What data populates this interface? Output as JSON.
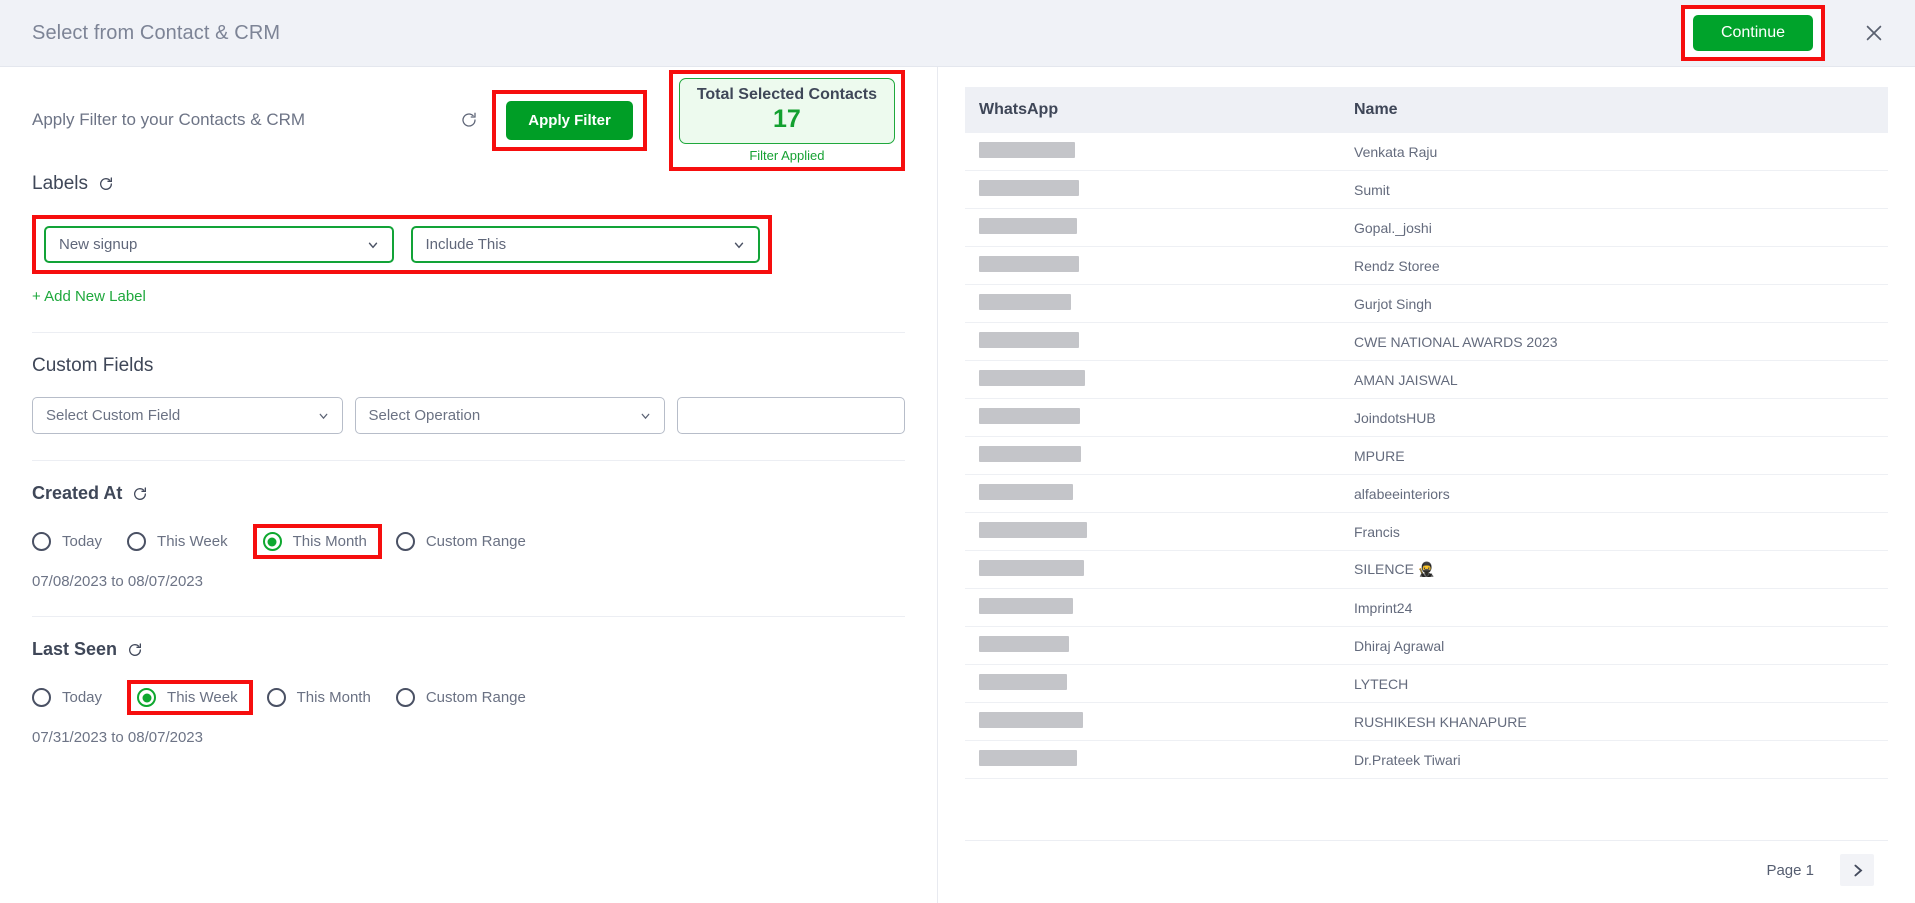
{
  "header": {
    "title": "Select from Contact & CRM",
    "continue_label": "Continue",
    "close_icon": "close-icon"
  },
  "filter": {
    "label": "Apply Filter to your Contacts & CRM",
    "refresh_icon": "refresh-icon",
    "apply_label": "Apply Filter",
    "total_title": "Total Selected Contacts",
    "total_value": "17",
    "status": "Filter Applied",
    "accent_green": "#00a32b",
    "highlight_red": "#f60e0e"
  },
  "labels_section": {
    "title": "Labels",
    "label_value": "New signup",
    "condition_value": "Include This",
    "add_new_label": "+ Add New Label"
  },
  "custom_fields": {
    "title": "Custom Fields",
    "field_placeholder": "Select Custom Field",
    "operation_placeholder": "Select Operation",
    "value_input": "",
    "value_placeholder": ""
  },
  "created_at": {
    "title": "Created At",
    "options": [
      {
        "label": "Today",
        "checked": false,
        "highlighted": false
      },
      {
        "label": "This Week",
        "checked": false,
        "highlighted": false
      },
      {
        "label": "This Month",
        "checked": true,
        "highlighted": true
      },
      {
        "label": "Custom Range",
        "checked": false,
        "highlighted": false
      }
    ],
    "range_text": "07/08/2023 to 08/07/2023"
  },
  "last_seen": {
    "title": "Last Seen",
    "options": [
      {
        "label": "Today",
        "checked": false,
        "highlighted": false
      },
      {
        "label": "This Week",
        "checked": true,
        "highlighted": true
      },
      {
        "label": "This Month",
        "checked": false,
        "highlighted": false
      },
      {
        "label": "Custom Range",
        "checked": false,
        "highlighted": false
      }
    ],
    "range_text": "07/31/2023 to 08/07/2023"
  },
  "contacts": {
    "columns": [
      "WhatsApp",
      "Name"
    ],
    "rows": [
      {
        "whatsapp": "",
        "redact_width": 96,
        "name": "Venkata Raju"
      },
      {
        "whatsapp": "",
        "redact_width": 100,
        "name": "Sumit"
      },
      {
        "whatsapp": "",
        "redact_width": 98,
        "name": "Gopal._joshi"
      },
      {
        "whatsapp": "",
        "redact_width": 100,
        "name": "Rendz Storee"
      },
      {
        "whatsapp": "",
        "redact_width": 92,
        "name": "Gurjot Singh"
      },
      {
        "whatsapp": "",
        "redact_width": 100,
        "name": "CWE NATIONAL AWARDS 2023"
      },
      {
        "whatsapp": "",
        "redact_width": 106,
        "name": "AMAN JAISWAL"
      },
      {
        "whatsapp": "",
        "redact_width": 101,
        "name": "JoindotsHUB"
      },
      {
        "whatsapp": "",
        "redact_width": 102,
        "name": "MPURE"
      },
      {
        "whatsapp": "",
        "redact_width": 94,
        "name": "alfabeeinteriors"
      },
      {
        "whatsapp": "",
        "redact_width": 108,
        "name": "Francis"
      },
      {
        "whatsapp": "",
        "redact_width": 105,
        "name": "SILENCE 🥷"
      },
      {
        "whatsapp": "",
        "redact_width": 94,
        "name": "Imprint24"
      },
      {
        "whatsapp": "",
        "redact_width": 90,
        "name": "Dhiraj Agrawal"
      },
      {
        "whatsapp": "",
        "redact_width": 88,
        "name": "LYTECH"
      },
      {
        "whatsapp": "",
        "redact_width": 104,
        "name": "RUSHIKESH KHANAPURE"
      },
      {
        "whatsapp": "",
        "redact_width": 98,
        "name": "Dr.Prateek Tiwari"
      }
    ],
    "page_label": "Page 1",
    "next_icon": "chevron-right-icon"
  }
}
